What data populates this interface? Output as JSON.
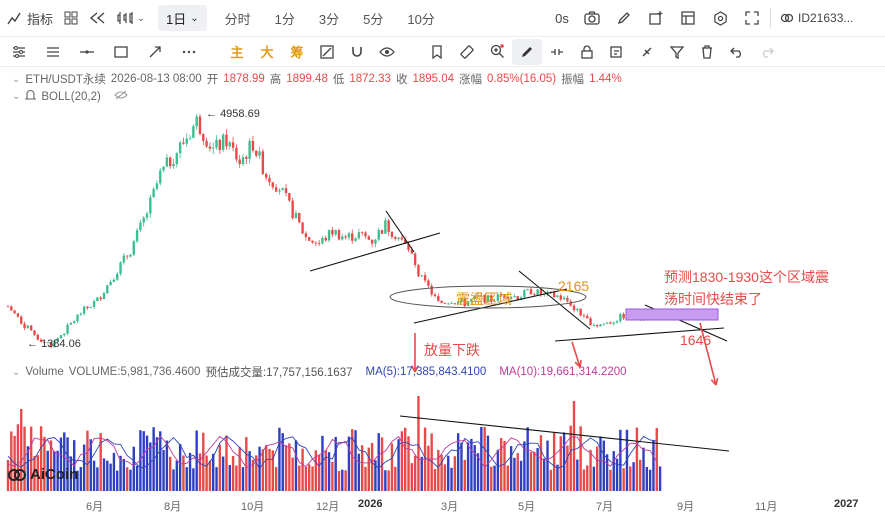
{
  "topbar": {
    "indicator_label": "指标",
    "period_selected": "1日",
    "periods": [
      "分时",
      "1分",
      "3分",
      "5分",
      "10分"
    ],
    "countdown": "0s",
    "account_id": "ID21633..."
  },
  "drawbar": {
    "zhu": "主",
    "da": "大",
    "chou": "筹"
  },
  "legend": {
    "symbol": "ETH/USDT永续",
    "datetime": "2026-08-13 08:00",
    "open_label": "开",
    "open": "1878.99",
    "high_label": "高",
    "high": "1899.48",
    "low_label": "低",
    "low": "1872.33",
    "close_label": "收",
    "close": "1895.04",
    "change_label": "涨幅",
    "change": "0.85%(16.05)",
    "amp_label": "振幅",
    "amp": "1.44%",
    "boll": "BOLL(20,2)"
  },
  "volume_legend": {
    "label": "Volume",
    "volume": "VOLUME:5,981,736.4600",
    "forecast": "预估成交量:17,757,156.1637",
    "ma5": "MA(5):17,385,843.4100",
    "ma10": "MA(10):19,661,314.2200"
  },
  "price_labels": {
    "high_mark": "4958.69",
    "low_mark": "1384.06"
  },
  "annotations": {
    "consolidation": "震盪区域",
    "level_2165": "2165",
    "forecast_text_1": "预测1830-1930这个区域震",
    "forecast_text_2": "荡时间快结束了",
    "level_1646": "1646",
    "volume_drop": "放量下跌"
  },
  "xaxis": [
    "6月",
    "8月",
    "10月",
    "12月",
    "2026",
    "3月",
    "5月",
    "7月",
    "9月",
    "11月",
    "2027"
  ],
  "brand": "AiCoin",
  "colors": {
    "up": "#3dbf8f",
    "down": "#e84a4a",
    "vol_up": "#2f3fc4",
    "vol_down": "#e84a4a",
    "annotation": "#e84a4a",
    "box": "#c89cf0"
  },
  "chart_data": {
    "type": "candlestick",
    "symbol": "ETH/USDT永续",
    "interval": "1日",
    "series_shape": [
      [
        0,
        2000
      ],
      [
        5,
        1700
      ],
      [
        9,
        1500
      ],
      [
        13,
        1384
      ],
      [
        17,
        1600
      ],
      [
        22,
        1900
      ],
      [
        27,
        2100
      ],
      [
        32,
        2500
      ],
      [
        37,
        2900
      ],
      [
        42,
        3500
      ],
      [
        46,
        4100
      ],
      [
        50,
        4400
      ],
      [
        54,
        4700
      ],
      [
        57,
        4958
      ],
      [
        62,
        4500
      ],
      [
        66,
        4650
      ],
      [
        70,
        4300
      ],
      [
        74,
        4600
      ],
      [
        78,
        4100
      ],
      [
        82,
        3900
      ],
      [
        86,
        3500
      ],
      [
        90,
        3100
      ],
      [
        94,
        3000
      ],
      [
        98,
        3200
      ],
      [
        102,
        3100
      ],
      [
        106,
        3150
      ],
      [
        110,
        3050
      ],
      [
        114,
        3300
      ],
      [
        118,
        3100
      ],
      [
        121,
        2900
      ],
      [
        124,
        2500
      ],
      [
        127,
        2300
      ],
      [
        130,
        2050
      ],
      [
        134,
        2100
      ],
      [
        138,
        2050
      ],
      [
        142,
        2150
      ],
      [
        146,
        2100
      ],
      [
        150,
        2200
      ],
      [
        154,
        2150
      ],
      [
        158,
        2250
      ],
      [
        162,
        2180
      ],
      [
        166,
        2165
      ],
      [
        170,
        2050
      ],
      [
        174,
        1800
      ],
      [
        178,
        1700
      ],
      [
        182,
        1750
      ],
      [
        186,
        1850
      ],
      [
        190,
        1830
      ],
      [
        194,
        1880
      ],
      [
        197,
        1895
      ]
    ],
    "labels": {
      "max": 4958.69,
      "min": 1384.06
    }
  }
}
